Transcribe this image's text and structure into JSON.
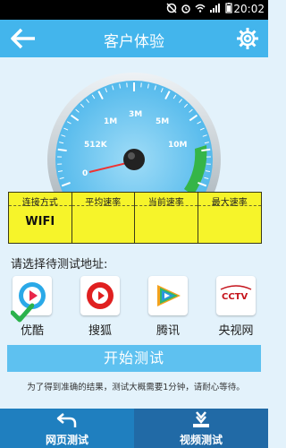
{
  "status_bar": {
    "time": "20:02"
  },
  "header": {
    "title": "客户体验",
    "back_label": "back",
    "settings_label": "settings"
  },
  "gauge": {
    "labels": [
      "0",
      "512K",
      "1M",
      "3M",
      "5M",
      "10M"
    ],
    "needle_value": "0",
    "colors": {
      "dial": "#5cc0ef",
      "green_band": "#35b548",
      "rim": "#cfd6dc"
    }
  },
  "stats": {
    "headers": [
      "连接方式",
      "平均速率",
      "当前速率",
      "最大速率"
    ],
    "values": [
      "WIFI",
      "",
      "",
      ""
    ]
  },
  "select_label": "请选择待测试地址:",
  "sites": [
    {
      "name": "优酷",
      "icon": "youku-icon",
      "selected": true
    },
    {
      "name": "搜狐",
      "icon": "sohu-icon",
      "selected": false
    },
    {
      "name": "腾讯",
      "icon": "tencent-video-icon",
      "selected": false
    },
    {
      "name": "央视网",
      "icon": "cctv-icon",
      "selected": false
    }
  ],
  "start_button": "开始测试",
  "hint": "为了得到准确的结果，测试大概需要1分钟，请耐心等待。",
  "bottom_tabs": [
    {
      "label": "网页测试",
      "icon": "web-test-icon"
    },
    {
      "label": "视频测试",
      "icon": "video-test-icon"
    }
  ]
}
